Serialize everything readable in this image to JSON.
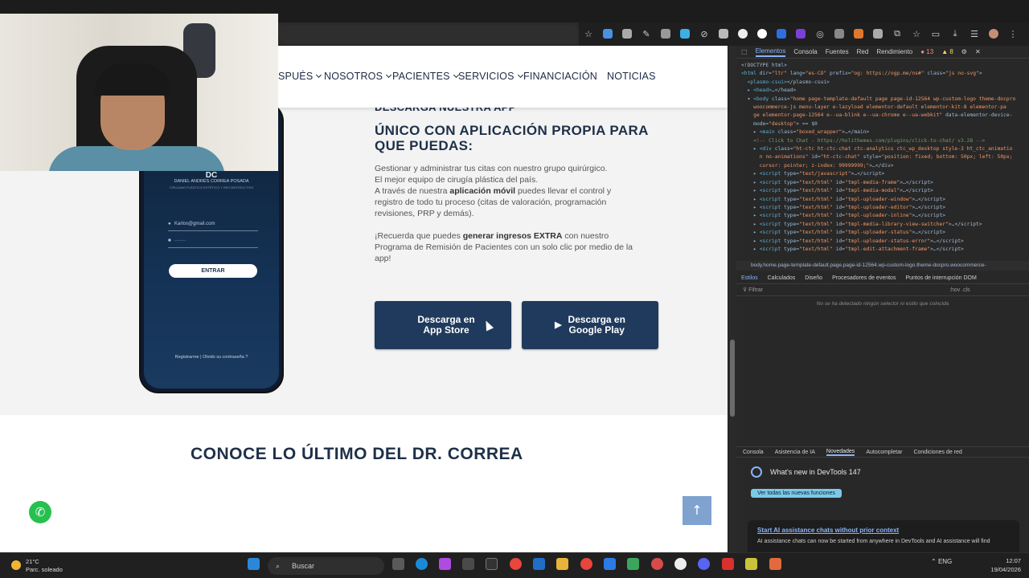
{
  "nav": {
    "items": [
      {
        "label": "SPUÉS",
        "chevron": true
      },
      {
        "label": "NOSOTROS",
        "chevron": true
      },
      {
        "label": "PACIENTES",
        "chevron": true
      },
      {
        "label": "SERVICIOS",
        "chevron": true
      },
      {
        "label": "FINANCIACIÓN",
        "chevron": false
      },
      {
        "label": "NOTICIAS",
        "chevron": false
      }
    ]
  },
  "app_section": {
    "kicker": "DESCARGA NUESTRA APP",
    "title": "ÚNICO CON APLICACIÓN PROPIA PARA QUE PUEDAS:",
    "p1_line1": "Gestionar y administrar tus citas con nuestro grupo quirúrgico.",
    "p1_line2": "El mejor equipo de cirugía plástica del país.",
    "p1_pre": "A través de nuestra ",
    "p1_bold": "aplicación móvil",
    "p1_post": " puedes llevar el control y registro de todo tu proceso (citas de valoración, programación revisiones, PRP y demás).",
    "p2_pre": "¡Recuerda que puedes ",
    "p2_bold": "generar ingresos EXTRA",
    "p2_post": " con nuestro Programa de Remisión de Pacientes con un solo clic por medio de la app!",
    "btn_appstore_line1": "Descarga en",
    "btn_appstore_line2": "App Store",
    "btn_googleplay_line1": "Descarga en",
    "btn_googleplay_line2": "Google Play"
  },
  "phone": {
    "brand_initials": "DC",
    "brand_name": "DANIEL ANDRÉS CORREA POSADA",
    "brand_sub": "CIRUJANO PLÁSTICO ESTÉTICO Y RECONSTRUCTIVO",
    "email_value": "Karlos@gmail.com",
    "password_value": "·······",
    "login_button": "ENTRAR",
    "register_link": "Registrarme",
    "forgot_link": "Olvido su contraseña ?"
  },
  "news_section": {
    "title": "CONOCE LO ÚLTIMO DEL DR. CORREA"
  },
  "devtools": {
    "tabs": [
      "Elementos",
      "Consola",
      "Fuentes",
      "Red",
      "Rendimiento"
    ],
    "error_count": "13",
    "warning_count": "8",
    "breadcrumb": "body.home.page-template-default.page.page-id-12564.wp-custom-logo.theme-docpro.woocommerce-",
    "styles_tabs": [
      "Estilos",
      "Calculados",
      "Diseño",
      "Procesadores de eventos",
      "Puntos de interrupción DOM"
    ],
    "filter_placeholder": "Filtrar",
    "filter_hint": ":hov .cls",
    "empty_message": "No se ha detectado ningún selector ni estilo que coincida",
    "drawer_tabs": [
      "Consola",
      "Asistencia de IA",
      "Novedades",
      "Autocompletar",
      "Condiciones de red"
    ],
    "whats_new": "What's new in DevTools 147",
    "see_all": "Ver todas las nuevas funciones",
    "card_title": "Start AI assistance chats without prior context",
    "card_text": "AI assistance chats can now be started from anywhere in DevTools and AI assistance will find"
  },
  "taskbar": {
    "temperature": "21°C",
    "weather": "Parc. soleado",
    "search_label": "Buscar",
    "language": "ENG",
    "time": "12:07",
    "date": "19/04/2026"
  },
  "colors": {
    "brand_navy": "#1f3a5c",
    "whatsapp_green": "#27c04f",
    "scroll_top_blue": "#7fa2cf"
  }
}
